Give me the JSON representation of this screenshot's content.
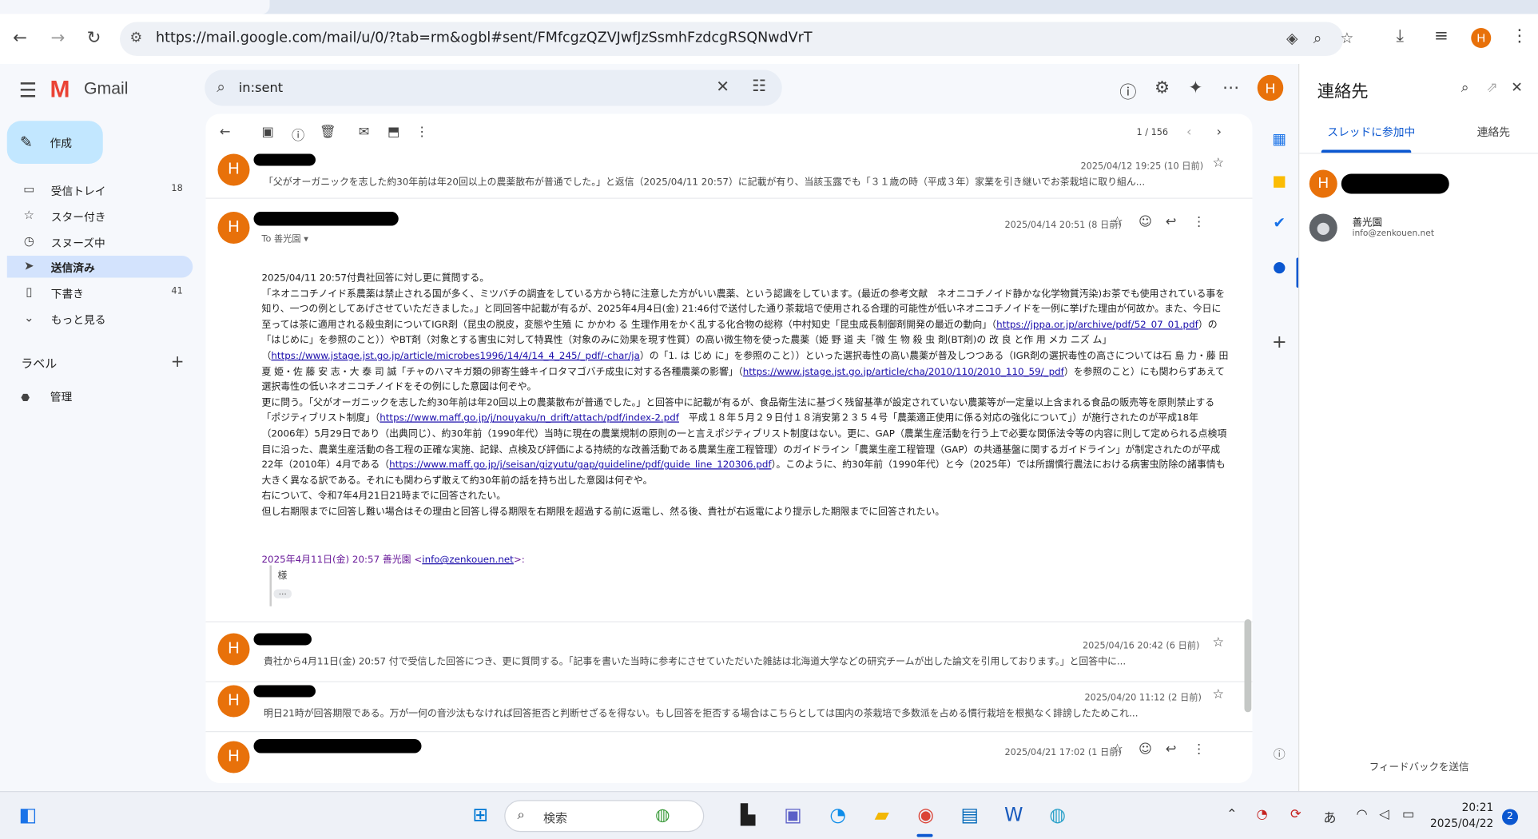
{
  "browser": {
    "url": "https://mail.google.com/mail/u/0/?tab=rm&ogbl#sent/FMfcgzQZVJwfJzSsmhFzdcgRSQNwdVrT",
    "profile_initial": "H"
  },
  "gmail": {
    "brand": "Gmail",
    "search_value": "in:sent",
    "compose_label": "作成",
    "nav": [
      {
        "label": "受信トレイ",
        "count": "18"
      },
      {
        "label": "スター付き",
        "count": ""
      },
      {
        "label": "スヌーズ中",
        "count": ""
      },
      {
        "label": "送信済み",
        "count": ""
      },
      {
        "label": "下書き",
        "count": "41"
      },
      {
        "label": "もっと見る",
        "count": ""
      }
    ],
    "labels_header": "ラベル",
    "labels": [
      {
        "label": "管理"
      }
    ],
    "pager": "1 / 156"
  },
  "thread": {
    "messages": [
      {
        "date": "2025/04/12 19:25 (10 日前)",
        "snippet": "「父がオーガニックを志した約30年前は年20回以上の農薬散布が普通でした。」と返信（2025/04/11 20:57）に記載が有り、当該玉露でも「３１歳の時（平成３年）家業を引き継いでお茶栽培に取り組ん..."
      },
      {
        "date": "2025/04/14 20:51 (8 日前)",
        "to": "To 善光園 ▾",
        "body": [
          "2025/04/11 20:57付貴社回答に対し更に質問する。",
          "「ネオニコチノイド系農薬は禁止される国が多く、ミツバチの調査をしている方から特に注意した方がいい農薬、という認識をしています。(最近の参考文献　ネオニコチノイド静かな化学物質汚染)お茶でも使用されている事を知り、一つの例としてあげさせていただきました。」と同回答中記載が有るが、2025年4月4日(金) 21:46付で送付した通り茶栽培で使用される合理的可能性が低いネオニコチノイドを一例に挙げた理由が何故か。また、今日に至っては茶に適用される殺虫剤についてIGR剤（昆虫の脱皮，変態や生殖 に かかわ る 生理作用をかく乱する化合物の総称（中村知史「昆虫成長制御剤開発の最近の動向」（",
          "https://jppa.or.jp/archive/pdf/52_07_01.pdf",
          "）の「はじめに」を参照のこと））やBT剤（対象とする害虫に対して特異性（対象のみに効果を現す性質）の高い微生物を使った農薬（姫 野 道 夫「微 生 物 殺 虫 剤(BT剤)の 改 良 と作 用 メカ ニズ ム」（",
          "https://www.jstage.jst.go.jp/article/microbes1996/14/4/14_4_245/_pdf/-char/ja",
          "）の「1. は じめ に」を参照のこと））といった選択毒性の高い農薬が普及しつつある（IGR剤の選択毒性の高さについては石 島 力・藤 田 夏 姫・佐 藤 安 志・大 泰 司 誠「チャのハマキガ類の卵寄生蜂キイロタマゴバチ成虫に対する各種農薬の影響」（",
          "https://www.jstage.jst.go.jp/article/cha/2010/110/2010_110_59/_pdf",
          "）を参照のこと）にも関わらずあえて選択毒性の低いネオニコチノイドをその例にした意図は何ぞや。",
          "更に問う。「父がオーガニックを志した約30年前は年20回以上の農薬散布が普通でした。」と回答中に記載が有るが、食品衛生法に基づく残留基準が設定されていない農薬等が一定量以上含まれる食品の販売等を原則禁止する「ポジティブリスト制度」（",
          "https://www.maff.go.jp/j/nouyaku/n_drift/attach/pdf/index-2.pdf",
          "　平成１８年５月２９日付１８消安第２３５４号「農薬適正使用に係る対応の強化について」）が施行されたのが平成18年（2006年）5月29日であり（出典同じ）、約30年前（1990年代）当時に現在の農業規制の原則の一と言えポジティブリスト制度はない。更に、GAP（農業生産活動を行う上で必要な関係法令等の内容に則して定められる点検項目に沿った、農業生産活動の各工程の正確な実施、記録、点検及び評価による持続的な改善活動である農業生産工程管理）のガイドライン「農業生産工程管理（GAP）の共通基盤に関するガイドライン」が制定されたのが平成22年（2010年）4月である（",
          "https://www.maff.go.jp/j/seisan/gizyutu/gap/guideline/pdf/guide_line_120306.pdf",
          "）。このように、約30年前（1990年代）と今（2025年）では所謂慣行農法における病害虫防除の諸事情も大きく異なる訳である。それにも関わらず敢えて約30年前の話を持ち出した意図は何ぞや。",
          "右について、令和7年4月21日21時までに回答されたい。",
          "但し右期限までに回答し難い場合はその理由と回答し得る期限を右期限を超過する前に返電し、然る後、貴社が右返電により提示した期限までに回答されたい。"
        ],
        "quote_header": "2025年4月11日(金) 20:57 善光園 <",
        "quote_email": "info@zenkouen.net",
        "quote_header_end": ">:",
        "quote_text": "様"
      },
      {
        "date": "2025/04/16 20:42 (6 日前)",
        "snippet": "貴社から4月11日(金) 20:57 付で受信した回答につき、更に質問する。「記事を書いた当時に参考にさせていただいた雑誌は北海道大学などの研究チームが出した論文を引用しております。」と回答中に..."
      },
      {
        "date": "2025/04/20 11:12 (2 日前)",
        "snippet": "明日21時が回答期限である。万が一何の音沙汰もなければ回答拒否と判断せざるを得ない。もし回答を拒否する場合はこちらとしては国内の茶栽培で多数派を占める慣行栽培を根拠なく誹謗したためこれ..."
      },
      {
        "date": "2025/04/21 17:02 (1 日前)"
      }
    ]
  },
  "contacts_panel": {
    "title": "連絡先",
    "tabs": [
      "スレッドに参加中",
      "連絡先"
    ],
    "contact_name": "善光園",
    "contact_email": "info@zenkouen.net",
    "feedback": "フィードバックを送信"
  },
  "taskbar": {
    "search_label": "検索",
    "ime": "あ",
    "time": "20:21",
    "date": "2025/04/22",
    "notification_count": "2"
  },
  "colors": {
    "avatar": "#e8710a",
    "active_nav": "#d3e3fd",
    "compose": "#c2e7ff",
    "accent": "#0b57d0"
  }
}
